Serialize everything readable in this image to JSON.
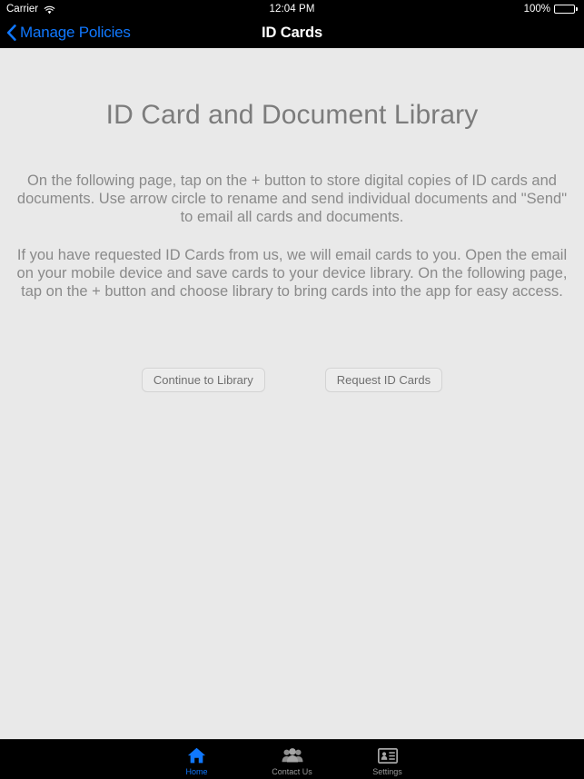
{
  "status_bar": {
    "carrier": "Carrier",
    "wifi_icon": "wifi-icon",
    "time": "12:04 PM",
    "battery_percent": "100%",
    "battery_icon": "battery-full-icon"
  },
  "nav_bar": {
    "back_icon": "chevron-left-icon",
    "back_label": "Manage Policies",
    "title": "ID Cards",
    "back_color": "#1078ff"
  },
  "content": {
    "heading": "ID Card and Document Library",
    "paragraph_1": "On the following page, tap on the + button to store digital copies of ID cards and documents. Use arrow circle to rename and send individual documents and \"Send\" to email all cards and documents.",
    "paragraph_2": "If you have requested ID Cards from us, we will email cards to you.  Open the email on your mobile device and save cards to your device library.  On the following page, tap on the + button and choose library to bring cards into the app for easy access.",
    "buttons": [
      {
        "label": "Continue to Library",
        "name": "continue-to-library-button"
      },
      {
        "label": "Request ID Cards",
        "name": "request-id-cards-button"
      }
    ]
  },
  "tab_bar": {
    "active_color": "#1078ff",
    "inactive_color": "#9a9a9a",
    "items": [
      {
        "label": "Home",
        "icon": "home-icon",
        "active": true
      },
      {
        "label": "Contact Us",
        "icon": "people-icon",
        "active": false
      },
      {
        "label": "Settings",
        "icon": "id-card-icon",
        "active": false
      }
    ]
  }
}
